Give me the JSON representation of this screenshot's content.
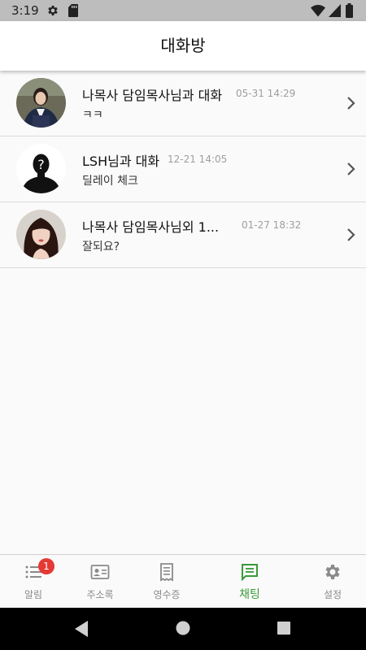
{
  "status_bar": {
    "time": "3:19",
    "icons": [
      "gear-icon",
      "sd-card-icon",
      "wifi-icon",
      "signal-icon",
      "battery-icon"
    ]
  },
  "header": {
    "title": "대화방"
  },
  "chats": [
    {
      "title": "나목사 담임목사님과 대화",
      "time": "05-31 14:29",
      "preview": "ㅋㅋ",
      "avatar": "photo-woman-school-uniform"
    },
    {
      "title": "LSH님과 대화",
      "time": "12-21 14:05",
      "preview": "딜레이 체크",
      "avatar": "unknown-user-silhouette"
    },
    {
      "title": "나목사 담임목사님외 1...",
      "time": "01-27 18:32",
      "preview": "잘되요?",
      "avatar": "photo-woman-long-hair"
    }
  ],
  "bottom_nav": [
    {
      "label": "알림",
      "icon": "list-icon",
      "badge": "1",
      "active": false
    },
    {
      "label": "주소록",
      "icon": "contact-card-icon",
      "active": false
    },
    {
      "label": "영수증",
      "icon": "receipt-icon",
      "active": false
    },
    {
      "label": "채팅",
      "icon": "chat-icon",
      "active": true
    },
    {
      "label": "설정",
      "icon": "settings-icon",
      "active": false
    }
  ],
  "colors": {
    "accent": "#3a9a3a",
    "badge": "#e53935",
    "status_bar": "#bdbdbd",
    "timestamp": "#9e9e9e"
  }
}
